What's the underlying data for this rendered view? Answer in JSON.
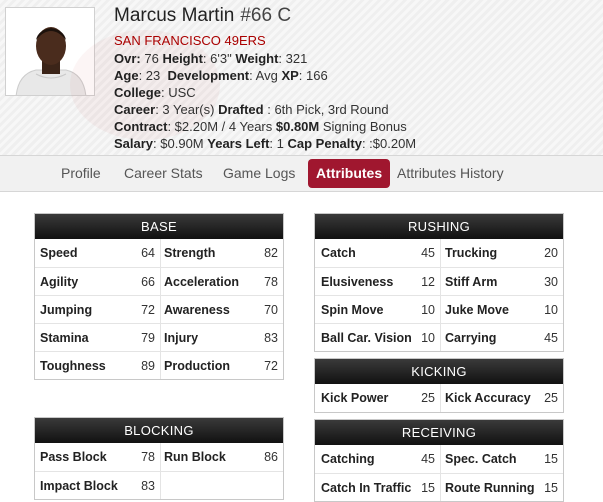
{
  "player": {
    "name": "Marcus Martin",
    "number_pos": "#66 C",
    "team": "SAN FRANCISCO 49ERS",
    "ovr_label": "Ovr:",
    "ovr": "76",
    "height_label": "Height",
    "height": ": 6'3\"",
    "weight_label": "Weight",
    "weight": ": 321",
    "age_label": "Age",
    "age": ": 23",
    "dev_label": "Development",
    "dev": ": Avg",
    "xp_label": "XP",
    "xp": ": 166",
    "college_label": "College",
    "college": ": USC",
    "career_label": "Career",
    "career": ": 3 Year(s)",
    "drafted_label": "Drafted",
    "drafted": " : 6th Pick, 3rd Round",
    "contract_label": "Contract",
    "contract": ": $2.20M / 4 Years",
    "signing_value": "$0.80M",
    "signing_text": " Signing Bonus",
    "salary_label": "Salary",
    "salary": ": $0.90M",
    "yearsleft_label": "Years Left",
    "yearsleft": ": 1",
    "cap_label": "Cap Penalty",
    "cap": ": :$0.20M"
  },
  "tabs": [
    "Profile",
    "Career Stats",
    "Game Logs",
    "Attributes",
    "Attributes History"
  ],
  "active_tab": "Attributes",
  "panels": {
    "base": {
      "title": "BASE",
      "rows": [
        [
          "Speed",
          "64",
          "Strength",
          "82"
        ],
        [
          "Agility",
          "66",
          "Acceleration",
          "78"
        ],
        [
          "Jumping",
          "72",
          "Awareness",
          "70"
        ],
        [
          "Stamina",
          "79",
          "Injury",
          "83"
        ],
        [
          "Toughness",
          "89",
          "Production",
          "72"
        ]
      ]
    },
    "blocking": {
      "title": "BLOCKING",
      "rows": [
        [
          "Pass Block",
          "78",
          "Run Block",
          "86"
        ],
        [
          "Impact Block",
          "83",
          "",
          ""
        ]
      ]
    },
    "rushing": {
      "title": "RUSHING",
      "rows": [
        [
          "Catch",
          "45",
          "Trucking",
          "20"
        ],
        [
          "Elusiveness",
          "12",
          "Stiff Arm",
          "30"
        ],
        [
          "Spin Move",
          "10",
          "Juke Move",
          "10"
        ],
        [
          "Ball Car. Vision",
          "10",
          "Carrying",
          "45"
        ]
      ]
    },
    "kicking": {
      "title": "KICKING",
      "rows": [
        [
          "Kick Power",
          "25",
          "Kick Accuracy",
          "25"
        ]
      ]
    },
    "receiving": {
      "title": "RECEIVING",
      "rows": [
        [
          "Catching",
          "45",
          "Spec. Catch",
          "15"
        ],
        [
          "Catch In Traffic",
          "15",
          "Route Running",
          "15"
        ]
      ]
    }
  },
  "colors": {
    "accent": "#a0172f",
    "team": "#aa0000",
    "header_dark": "#1a1a1a"
  }
}
